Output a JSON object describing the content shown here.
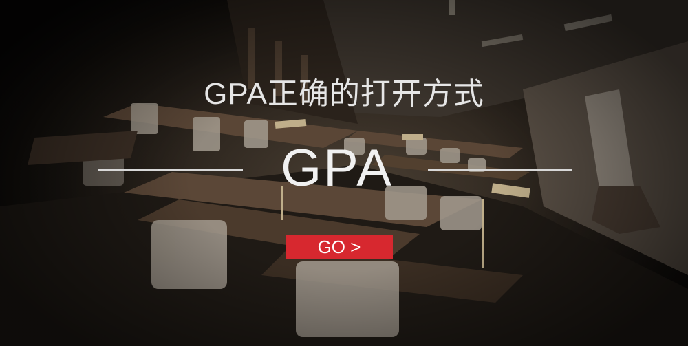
{
  "banner": {
    "subtitle": "GPA正确的打开方式",
    "title": "GPA",
    "cta_label": "GO >",
    "background_description_icon": "library-study-room-photo",
    "colors": {
      "cta_background": "#d7282f",
      "text": "#f1f1f1",
      "rule": "#d8d8d8"
    }
  }
}
